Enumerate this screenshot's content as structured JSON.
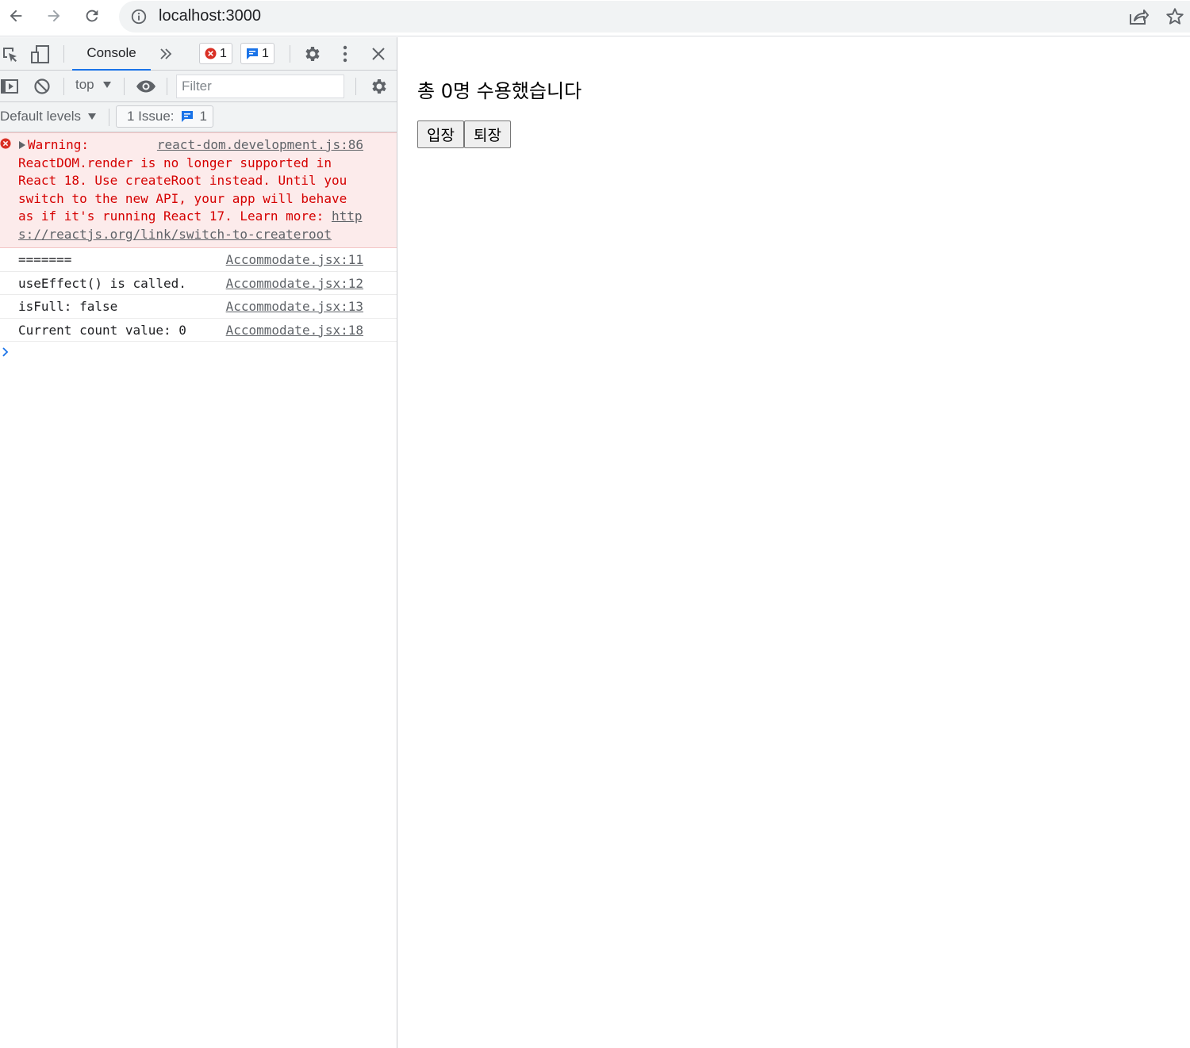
{
  "browser": {
    "url": "localhost:3000",
    "icons": [
      "back-arrow-icon",
      "forward-arrow-icon",
      "reload-icon",
      "info-icon",
      "share-icon",
      "star-icon"
    ]
  },
  "devtools": {
    "tabs": {
      "console_label": "Console",
      "more_icon": "chevron-double-right-icon"
    },
    "error_count": "1",
    "message_count": "1",
    "context_value": "top",
    "filter_placeholder": "Filter",
    "levels_label": "Default levels",
    "issues_label": "1 Issue:",
    "issues_count": "1",
    "colors": {
      "error": "#d50000",
      "accent": "#1a73e8",
      "error_bg": "#fcebeb"
    },
    "error_message": {
      "prefix": "Warning:",
      "source": "react-dom.development.js:86",
      "text": "ReactDOM.render is no longer supported in React 18. Use createRoot instead. Until you switch to the new API, your app will behave as if it's running React 17. Learn more:",
      "link": "https://reactjs.org/link/switch-to-createroot"
    },
    "log_messages": [
      {
        "text": "=======",
        "source": "Accommodate.jsx:11"
      },
      {
        "text": "useEffect() is called.",
        "source": "Accommodate.jsx:12"
      },
      {
        "text": "isFull: false",
        "source": "Accommodate.jsx:13"
      },
      {
        "text": "Current count value: 0",
        "source": "Accommodate.jsx:18"
      }
    ]
  },
  "page": {
    "title": "총 0명 수용했습니다",
    "enter_button": "입장",
    "exit_button": "퇴장"
  }
}
